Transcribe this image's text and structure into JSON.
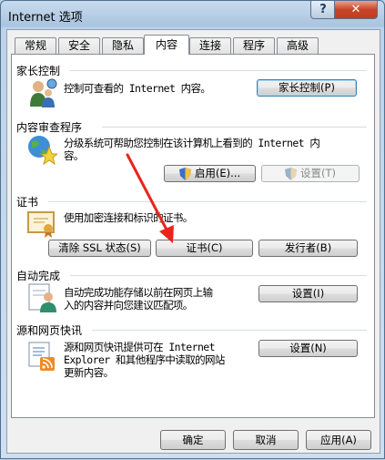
{
  "window": {
    "title": "Internet 选项"
  },
  "titlebar": {
    "help_label": "?",
    "close_label": "✕"
  },
  "tabs": [
    {
      "label": "常规"
    },
    {
      "label": "安全"
    },
    {
      "label": "隐私"
    },
    {
      "label": "内容"
    },
    {
      "label": "连接"
    },
    {
      "label": "程序"
    },
    {
      "label": "高级"
    }
  ],
  "parental": {
    "title": "家长控制",
    "desc": "控制可查看的 Internet 内容。",
    "button": "家长控制(P)"
  },
  "advisor": {
    "title": "内容审查程序",
    "desc_line1": "分级系统可帮助您控制在该计算机上看到的 Internet 内",
    "desc_line2": "容。",
    "enable_button": "启用(E)...",
    "settings_button": "设置(T)"
  },
  "certificates": {
    "title": "证书",
    "desc": "使用加密连接和标识的证书。",
    "clear_ssl_button": "清除 SSL 状态(S)",
    "certs_button": "证书(C)",
    "publishers_button": "发行者(B)"
  },
  "autocomplete": {
    "title": "自动完成",
    "desc_line1": "自动完成功能存储以前在网页上输",
    "desc_line2": "入的内容并向您建议匹配项。",
    "settings_button": "设置(I)"
  },
  "feeds": {
    "title": "源和网页快讯",
    "desc_line1": "源和网页快讯提供可在 Internet",
    "desc_line2": "Explorer 和其他程序中读取的网站",
    "desc_line3": "更新内容。",
    "settings_button": "设置(N)"
  },
  "footer": {
    "ok_button": "确定",
    "cancel_button": "取消",
    "apply_button": "应用(A)"
  },
  "annotation": {
    "arrow_color": "#e8251b"
  }
}
